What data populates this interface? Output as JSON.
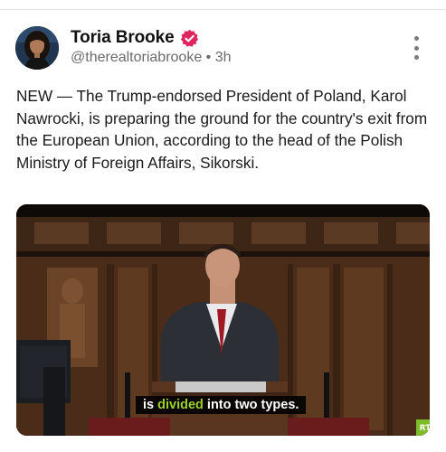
{
  "post": {
    "author_name": "Toria Brooke",
    "handle": "@therealtoriabrooke",
    "separator": "•",
    "time_ago": "3h",
    "text": "NEW — The Trump-endorsed President of Poland, Karol Nawrocki, is preparing the ground for the country's exit from the European Union, according to the head of the Polish Ministry of Foreign Affairs, Sikorski."
  },
  "icons": {
    "verified": "verified-badge-icon",
    "more": "more-vertical-icon"
  },
  "media": {
    "caption_before": "is ",
    "caption_highlight": "divided",
    "caption_after": " into two types.",
    "logo_text": "RT"
  },
  "colors": {
    "verified_badge": "#e0245e",
    "caption_highlight": "#98d12a",
    "rt_logo": "#7dbb2a"
  }
}
